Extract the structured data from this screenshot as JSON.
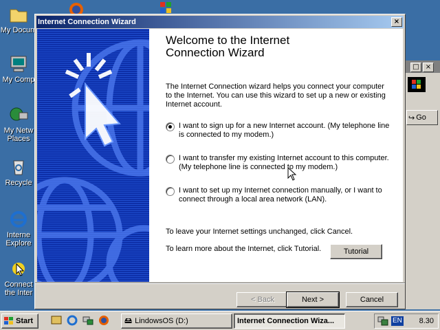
{
  "desktop": {
    "icons": [
      {
        "label": "My Docum",
        "icon": "folder-icon"
      },
      {
        "label": "My Comp",
        "icon": "computer-icon"
      },
      {
        "label": "My Netw\nPlaces",
        "icon": "network-icon"
      },
      {
        "label": "Recycle",
        "icon": "recycle-bin-icon"
      },
      {
        "label": "Interne\nExplore",
        "icon": "internet-explorer-icon"
      },
      {
        "label": "Connect\nthe Inter",
        "icon": "connect-icon"
      }
    ]
  },
  "background_window": {
    "go_label": "Go"
  },
  "wizard": {
    "title": "Internet Connection Wizard",
    "heading": "Welcome to the Internet Connection Wizard",
    "intro": "The Internet Connection wizard helps you connect your computer to the Internet.  You can use this wizard to set up a new or existing Internet account.",
    "options": [
      {
        "text": "I want to sign up for a new Internet account. (My telephone line is connected to my modem.)",
        "selected": true
      },
      {
        "text": "I want to transfer my existing Internet account to this computer. (My telephone line is connected to my modem.)",
        "selected": false
      },
      {
        "text": "I want to set up my Internet connection manually, or I want to connect through a local area network (LAN).",
        "selected": false
      }
    ],
    "cancel_note": "To leave your Internet settings unchanged, click Cancel.",
    "tutorial_note": "To learn more about the Internet, click Tutorial.",
    "tutorial_button": "Tutorial",
    "back_button": "< Back",
    "next_button": "Next >",
    "cancel_button": "Cancel",
    "colors": {
      "side_panel": "#0d2fa8",
      "title_start": "#0a246a",
      "title_end": "#a6caf0"
    }
  },
  "taskbar": {
    "start_label": "Start",
    "tasks": [
      {
        "label": "LindowsOS (D:)",
        "active": false
      },
      {
        "label": "Internet Connection Wiza...",
        "active": true
      }
    ],
    "language": "EN",
    "clock": "8.30"
  }
}
